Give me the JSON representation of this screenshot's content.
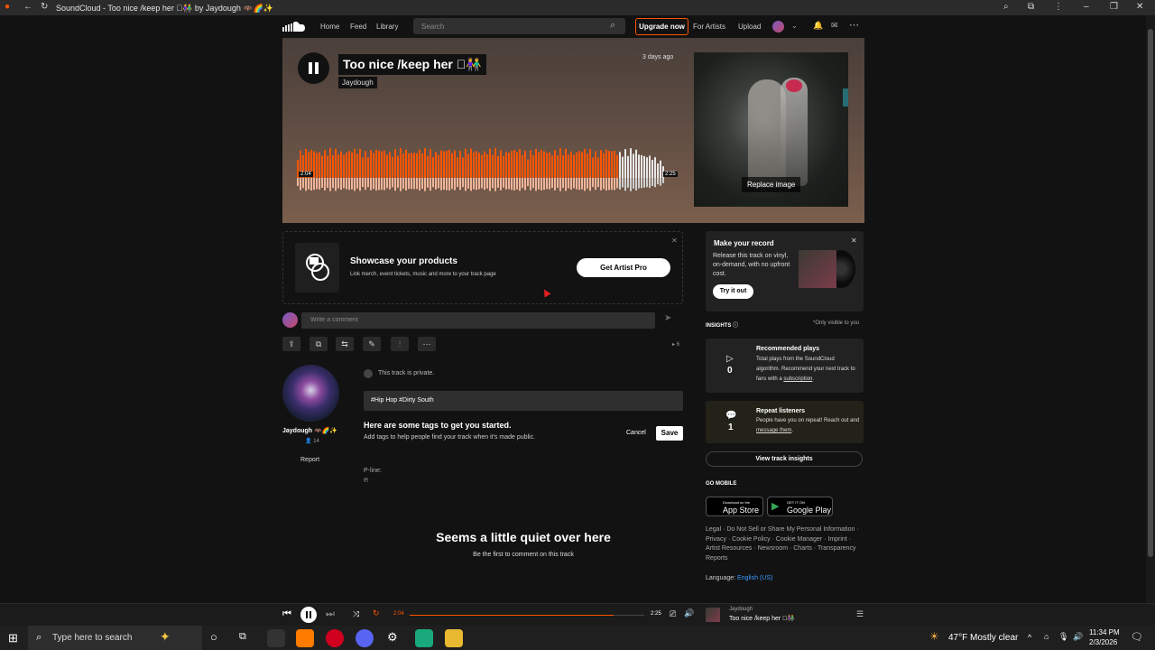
{
  "window": {
    "title": "SoundCloud - Too nice /keep her 🏿👫 by Jaydough 🦇🌈✨"
  },
  "nav": {
    "home": "Home",
    "feed": "Feed",
    "library": "Library",
    "search_placeholder": "Search",
    "upgrade": "Upgrade now",
    "for_artists": "For Artists",
    "upload": "Upload"
  },
  "hero": {
    "title": "Too nice /keep her 🏿👫",
    "artist": "Jaydough",
    "posted": "3 days ago",
    "time_elapsed": "2:04",
    "time_total": "2:25",
    "progress": 0.87,
    "replace_image": "Replace image"
  },
  "promo": {
    "heading": "Showcase your products",
    "desc": "Link merch, event tickets, music and more to your track page",
    "button": "Get Artist Pro"
  },
  "comment": {
    "placeholder": "Write a comment"
  },
  "actions": {
    "count": "6"
  },
  "uploader": {
    "name": "Jaydough 🦇🌈✨",
    "followers": "14",
    "report": "Report"
  },
  "track": {
    "private_note": "This track is private.",
    "tags": "#Hip Hop  #Dirty South",
    "tags_heading": "Here are some tags to get you started.",
    "tags_desc": "Add tags to help people find your track when it's made public.",
    "cancel": "Cancel",
    "save": "Save",
    "pline_label": "P-line:",
    "pline_value": "℗"
  },
  "empty_comments": {
    "heading": "Seems a little quiet over here",
    "sub": "Be the first to comment on this track"
  },
  "record": {
    "heading": "Make your record",
    "desc": "Release this track on vinyl, on-demand, with no upfront cost.",
    "button": "Try it out"
  },
  "insights": {
    "label": "INSIGHTS",
    "only_you": "*Only visible to you",
    "plays_title": "Recommended plays",
    "plays_count": "0",
    "plays_desc": "Total plays from the SoundCloud algorithm. Recommend your next track to fans with a",
    "plays_link": "subscription",
    "repeat_title": "Repeat listeners",
    "repeat_count": "1",
    "repeat_desc": "People have you on repeat! Reach out and",
    "repeat_link": "message them",
    "view_button": "View track insights"
  },
  "mobile": {
    "label": "GO MOBILE",
    "app_store_small": "Download on the",
    "app_store": "App Store",
    "google_small": "GET IT ON",
    "google": "Google Play"
  },
  "footer": {
    "line1": "Legal · Do Not Sell or Share My Personal Information ·",
    "line2": "Privacy · Cookie Policy · Cookie Manager · Imprint ·",
    "line3": "Artist Resources · Newsroom · Charts · Transparency",
    "line4": "Reports",
    "language_label": "Language:",
    "language_value": "English (US)"
  },
  "player": {
    "elapsed": "2:04",
    "total": "2:25",
    "artist": "Jaydough",
    "title": "Too nice /keep her 🏿👫"
  },
  "taskbar": {
    "search_placeholder": "Type here to search",
    "weather": "47°F  Mostly clear",
    "time": "11:34 PM",
    "date": "2/3/2026"
  },
  "colors": {
    "accent": "#ff5500",
    "link": "#3d9bff"
  }
}
